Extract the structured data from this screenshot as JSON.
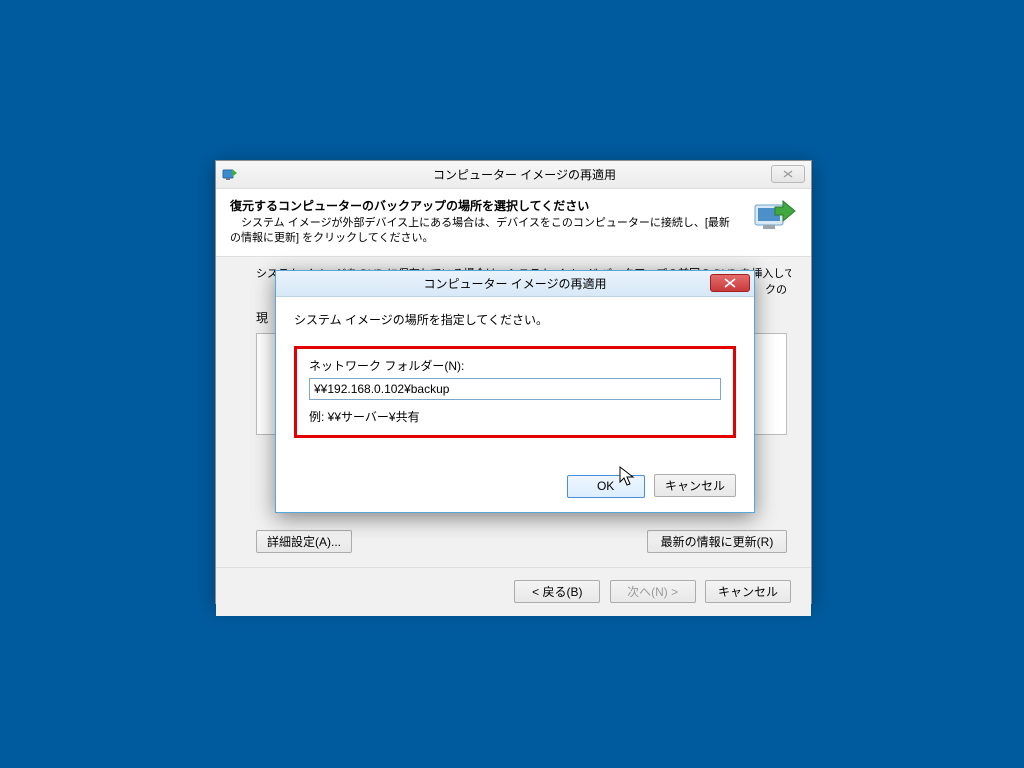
{
  "parent": {
    "title": "コンピューター イメージの再適用",
    "heading": "復元するコンピューターのバックアップの場所を選択してください",
    "sub": "システム イメージが外部デバイス上にある場合は、デバイスをこのコンピューターに接続し、[最新の情報に更新] をクリックしてください。",
    "dvd_line": "システム イメージを DVD に保存している場合は、システム イメージ バックアップの前回の DVD を挿入してくださ",
    "dvd_line2": "クの",
    "current_label": "現",
    "advanced_btn": "詳細設定(A)...",
    "refresh_btn": "最新の情報に更新(R)",
    "back_btn": "< 戻る(B)",
    "next_btn": "次へ(N) >",
    "cancel_btn": "キャンセル"
  },
  "modal": {
    "title": "コンピューター イメージの再適用",
    "instruction": "システム イメージの場所を指定してください。",
    "field_label": "ネットワーク フォルダー(N):",
    "field_value": "¥¥192.168.0.102¥backup",
    "example": "例: ¥¥サーバー¥共有",
    "ok": "OK",
    "cancel": "キャンセル"
  }
}
